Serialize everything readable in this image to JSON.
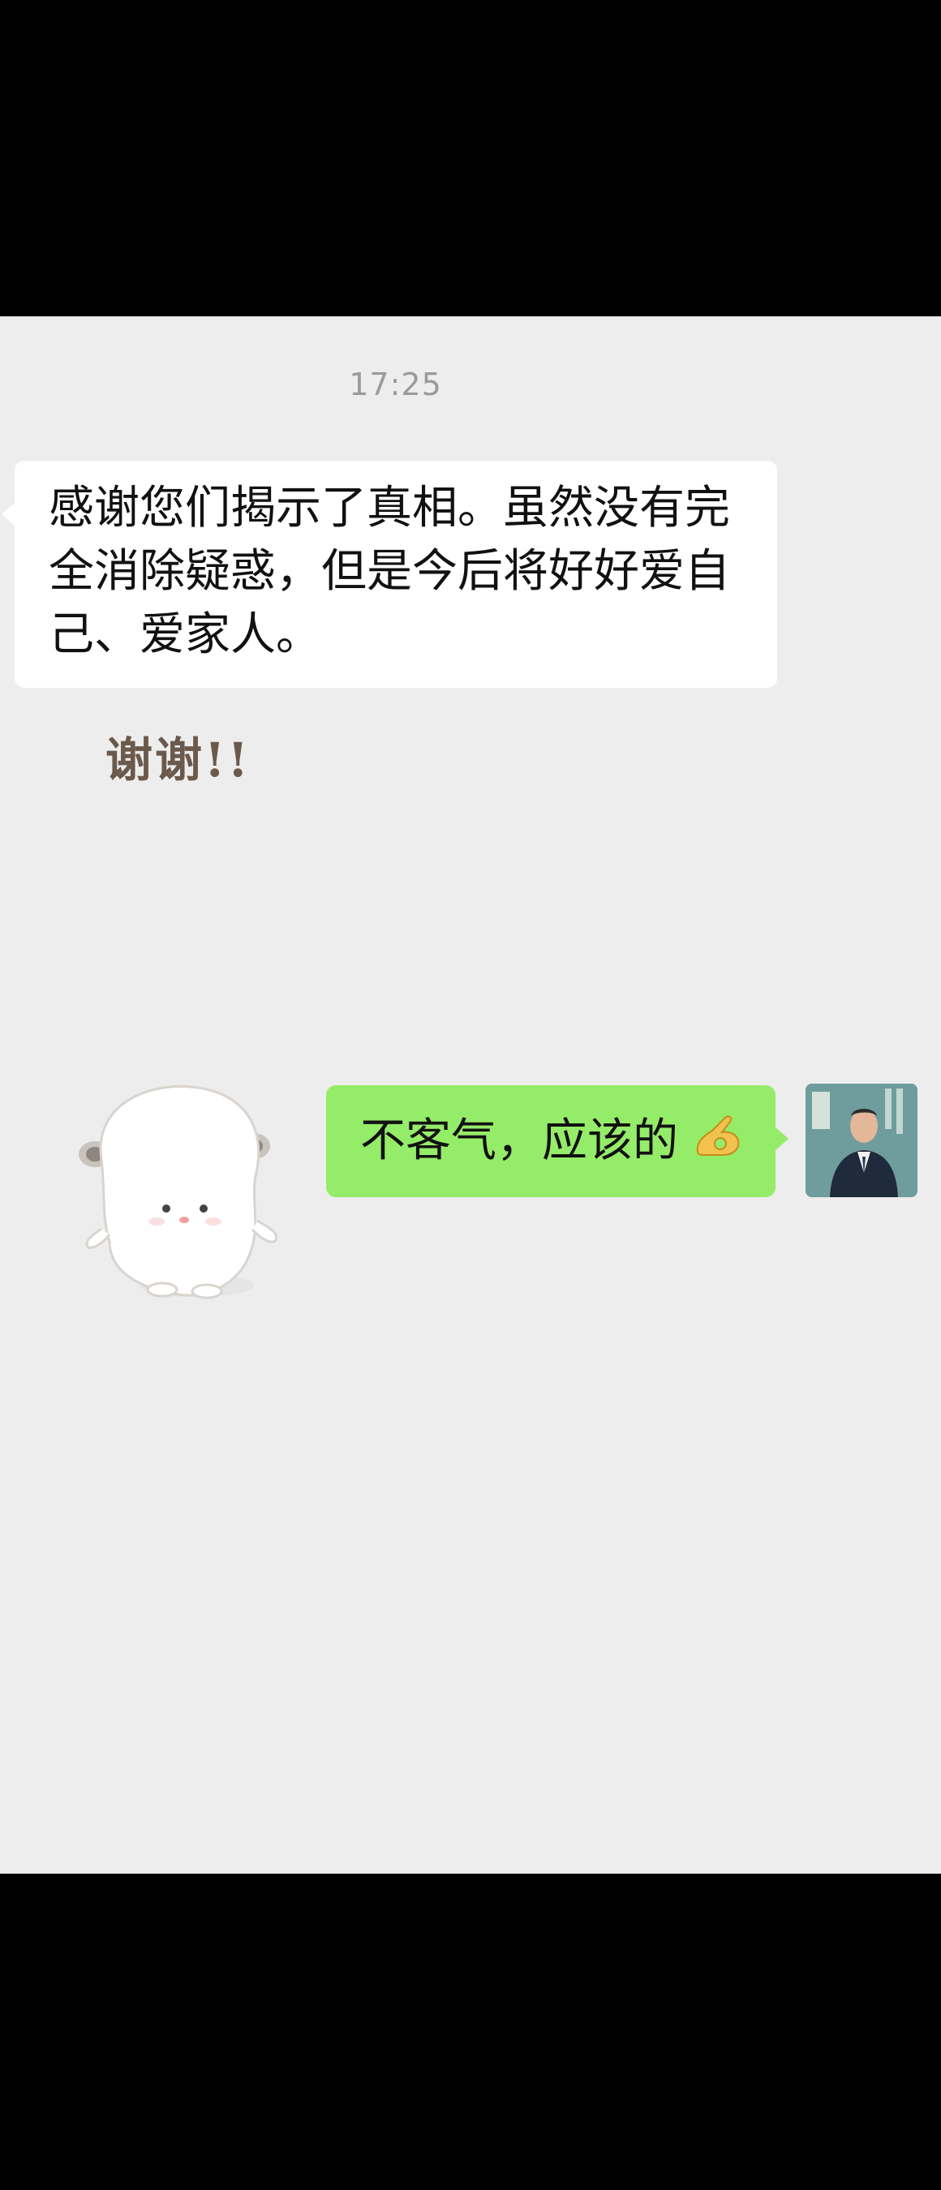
{
  "chat": {
    "timestamp": "17:25",
    "incoming_message": "感谢您们揭示了真相。虽然没有完全消除疑惑，但是今后将好好爱自己、爱家人。",
    "sticker_text": "谢谢!!",
    "outgoing_message": "不客气，应该的"
  },
  "icons": {
    "outgoing_emoji": "ok-hand-emoji",
    "avatar": "user-avatar"
  },
  "colors": {
    "chat_background": "#ededed",
    "incoming_bubble": "#ffffff",
    "outgoing_bubble": "#95ec69"
  }
}
